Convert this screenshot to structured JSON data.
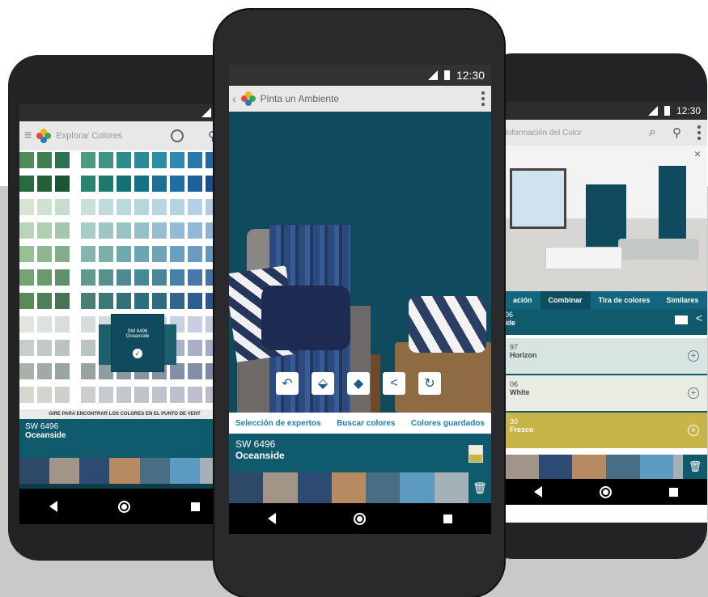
{
  "left_phone": {
    "status_time": "",
    "appbar_title": "Explorar Colores",
    "banner": "GIRE PARA ENCONTRAR LOS COLORES EN EL PUNTO DE VENT",
    "selected_code": "SW 6496",
    "selected_name": "Oceanside",
    "chip_code": "SW 6496",
    "chip_name": "Oceanside",
    "grid_colors": [
      [
        "#4f8b5b",
        "#3f7f52",
        "#2f7150",
        "#4c9a84",
        "#3e9385",
        "#2b8e8a",
        "#2a8c97",
        "#2d8da1",
        "#2f8ab0",
        "#2a78ab",
        "#2366a0"
      ],
      [
        "#2a6b3e",
        "#23603a",
        "#1d5436",
        "#2a8270",
        "#1e7a6e",
        "#127173",
        "#137285",
        "#1f6e93",
        "#1f6ea4",
        "#1f5f9a",
        "#1a4e8a"
      ],
      [
        "#d5e5d2",
        "#cfe1cf",
        "#c7dccb",
        "#c7e0db",
        "#c1dcda",
        "#bad9da",
        "#b7d6dc",
        "#b9d6e0",
        "#b6d3e4",
        "#b5d0e5",
        "#b2cbe2"
      ],
      [
        "#b9d4b6",
        "#b0ceb2",
        "#a7c7ad",
        "#a8ccc6",
        "#9fc6c3",
        "#97c3c5",
        "#93c0c9",
        "#96c0cd",
        "#93bcd4",
        "#92b8d6",
        "#8fb3d3"
      ],
      [
        "#98bf95",
        "#8db691",
        "#82ae8c",
        "#85b6ae",
        "#79aeab",
        "#70a9ad",
        "#6aa6b2",
        "#6da5b6",
        "#6aa0bf",
        "#6a9cc1",
        "#6597be"
      ],
      [
        "#74a472",
        "#69996f",
        "#5f906b",
        "#62998f",
        "#56918e",
        "#4b8b91",
        "#458898",
        "#47859c",
        "#4680a7",
        "#4778a8",
        "#4572a4"
      ],
      [
        "#5a8a59",
        "#4f7f56",
        "#457552",
        "#497f75",
        "#3d7774",
        "#327177",
        "#2c6d7e",
        "#2e6a83",
        "#2f658e",
        "#2f5d8f",
        "#2d578a"
      ],
      [
        "#e2e5e0",
        "#dde2dd",
        "#d8dfdb",
        "#d6dedd",
        "#d1dbdb",
        "#ccd8dc",
        "#c9d5dd",
        "#cbd4df",
        "#c9d2e0",
        "#c8cfe0",
        "#c6ccde"
      ],
      [
        "#c8cec8",
        "#c1c9c4",
        "#bbc4c0",
        "#bac4c3",
        "#b3bfbf",
        "#adbbbf",
        "#a9b8c0",
        "#abb6c3",
        "#a9b3c5",
        "#a8b0c5",
        "#a5adc2"
      ],
      [
        "#a8b2a9",
        "#a0aba4",
        "#98a5a0",
        "#97a3a3",
        "#8f9d9f",
        "#8898a0",
        "#8495a2",
        "#8693a5",
        "#8390a8",
        "#828da8",
        "#7f89a5"
      ],
      [
        "#d9d6cf",
        "#d4d3cd",
        "#cfd0cb",
        "#ccced0",
        "#c8cbcd",
        "#c3c7cb",
        "#bfc4ca",
        "#c0c2cc",
        "#bec0cd",
        "#bcbece",
        "#babbcc"
      ]
    ],
    "strip": [
      "#2c4a67",
      "#a29587",
      "#2d4a74",
      "#b88a62",
      "#486e85",
      "#5d9ac2",
      "#a4b1b6"
    ]
  },
  "center_phone": {
    "status_time": "12:30",
    "appbar_title": "Pinta un Ambiente",
    "room_wall_color": "#0f4a5e",
    "tools": [
      "undo-icon",
      "paint-bucket-icon",
      "eraser-icon",
      "share-icon",
      "rotate-icon"
    ],
    "links": {
      "experts": "Selección de expertos",
      "search": "Buscar colores",
      "saved": "Colores guardados"
    },
    "selected_code": "SW 6496",
    "selected_name": "Oceanside",
    "strip": [
      "#2c4a67",
      "#a29587",
      "#2d4a74",
      "#b88a62",
      "#486e85",
      "#5d9ac2",
      "#a4b1b6"
    ]
  },
  "right_phone": {
    "status_time": "12:30",
    "appbar_title": "Información del Color",
    "tabs": {
      "info": "ación",
      "combine": "Combinar",
      "strip": "Tira de colores",
      "similar": "Similares"
    },
    "selected_code_partial": "06",
    "selected_name_partial": "ide",
    "combos": [
      {
        "code": "97",
        "name": "Horizon",
        "color": "#d6e4e2"
      },
      {
        "code": "06",
        "name": "White",
        "color": "#e9ece3"
      },
      {
        "code": "30",
        "name": "Fresco",
        "color": "#c8b547"
      }
    ],
    "strip": [
      "#a29587",
      "#2d4a74",
      "#b88a62",
      "#486e85",
      "#5d9ac2",
      "#a4b1b6"
    ]
  }
}
